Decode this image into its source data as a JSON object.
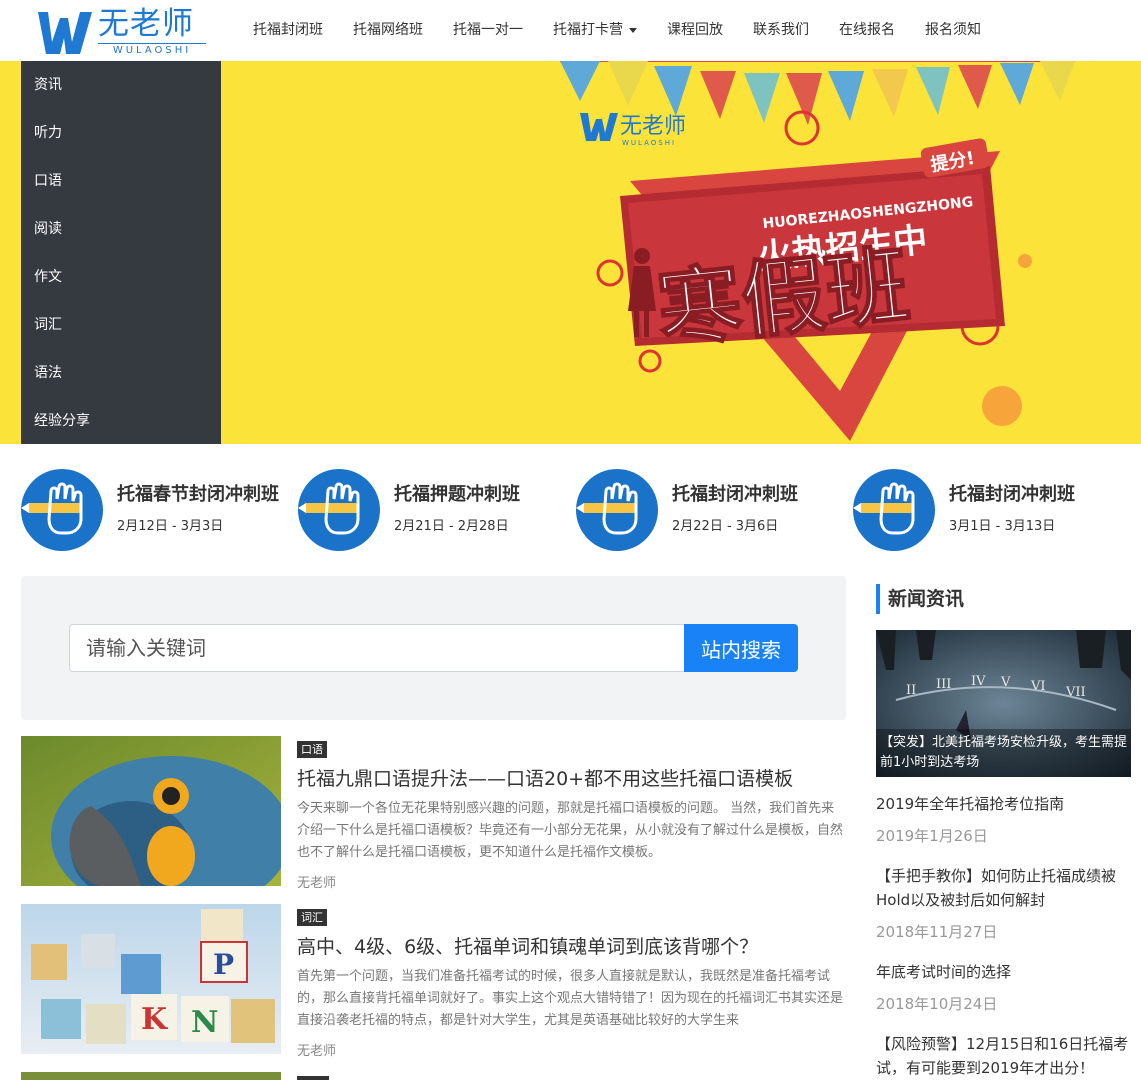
{
  "brand": {
    "name_cn": "无老师",
    "name_en": "WULAOSHI",
    "color": "#1f78d1"
  },
  "nav": [
    {
      "label": "托福封闭班"
    },
    {
      "label": "托福网络班"
    },
    {
      "label": "托福一对一"
    },
    {
      "label": "托福打卡营",
      "dropdown": true
    },
    {
      "label": "课程回放"
    },
    {
      "label": "联系我们"
    },
    {
      "label": "在线报名"
    },
    {
      "label": "报名须知"
    }
  ],
  "sidebar": {
    "items": [
      {
        "label": "资讯"
      },
      {
        "label": "听力"
      },
      {
        "label": "口语"
      },
      {
        "label": "阅读"
      },
      {
        "label": "作文"
      },
      {
        "label": "词汇"
      },
      {
        "label": "语法"
      },
      {
        "label": "经验分享"
      }
    ]
  },
  "banner": {
    "logo_cn": "无老师",
    "logo_en": "WULAOSHI",
    "badge": "提分!",
    "pinyin": "HUOREZHAOSHENGZHONG",
    "headline": "火热招生中",
    "title": "寒假班",
    "bg_color": "#fce33a"
  },
  "courses": [
    {
      "title": "托福春节封闭冲刺班",
      "dates": "2月12日 - 3月3日"
    },
    {
      "title": "托福押题冲刺班",
      "dates": "2月21日 - 2月28日"
    },
    {
      "title": "托福封闭冲刺班",
      "dates": "2月22日 - 3月6日"
    },
    {
      "title": "托福封闭冲刺班",
      "dates": "3月1日 - 3月13日"
    }
  ],
  "search": {
    "placeholder": "请输入关键词",
    "button": "站内搜索"
  },
  "articles": [
    {
      "tag": "口语",
      "title": "托福九鼎口语提升法——口语20+都不用这些托福口语模板",
      "excerpt": "今天来聊一个各位无花果特别感兴趣的问题，那就是托福口语模板的问题。 当然，我们首先来介绍一下什么是托福口语模板？毕竟还有一小部分无花果，从小就没有了解过什么是模板，自然也不了解什么是托福口语模板，更不知道什么是托福作文模板。",
      "author": "无老师"
    },
    {
      "tag": "词汇",
      "title": "高中、4级、6级、托福单词和镇魂单词到底该背哪个？",
      "excerpt": "首先第一个问题，当我们准备托福考试的时候，很多人直接就是默认，我既然是准备托福考试的，那么直接背托福单词就好了。事实上这个观点大错特错了！因为现在的托福词汇书其实还是直接沿袭老托福的特点，都是针对大学生，尤其是英语基础比较好的大学生来",
      "author": "无老师"
    }
  ],
  "news": {
    "heading": "新闻资讯",
    "featured_caption": "【突发】北美托福考场安检升级，考生需提前1小时到达考场",
    "items": [
      {
        "title": "2019年全年托福抢考位指南",
        "date": "2019年1月26日"
      },
      {
        "title": "【手把手教你】如何防止托福成绩被Hold以及被封后如何解封",
        "date": "2018年11月27日"
      },
      {
        "title": "年底考试时间的选择",
        "date": "2018年10月24日"
      },
      {
        "title": "【风险预警】12月15日和16日托福考试，有可能要到2019年才出分！",
        "date": ""
      }
    ]
  }
}
